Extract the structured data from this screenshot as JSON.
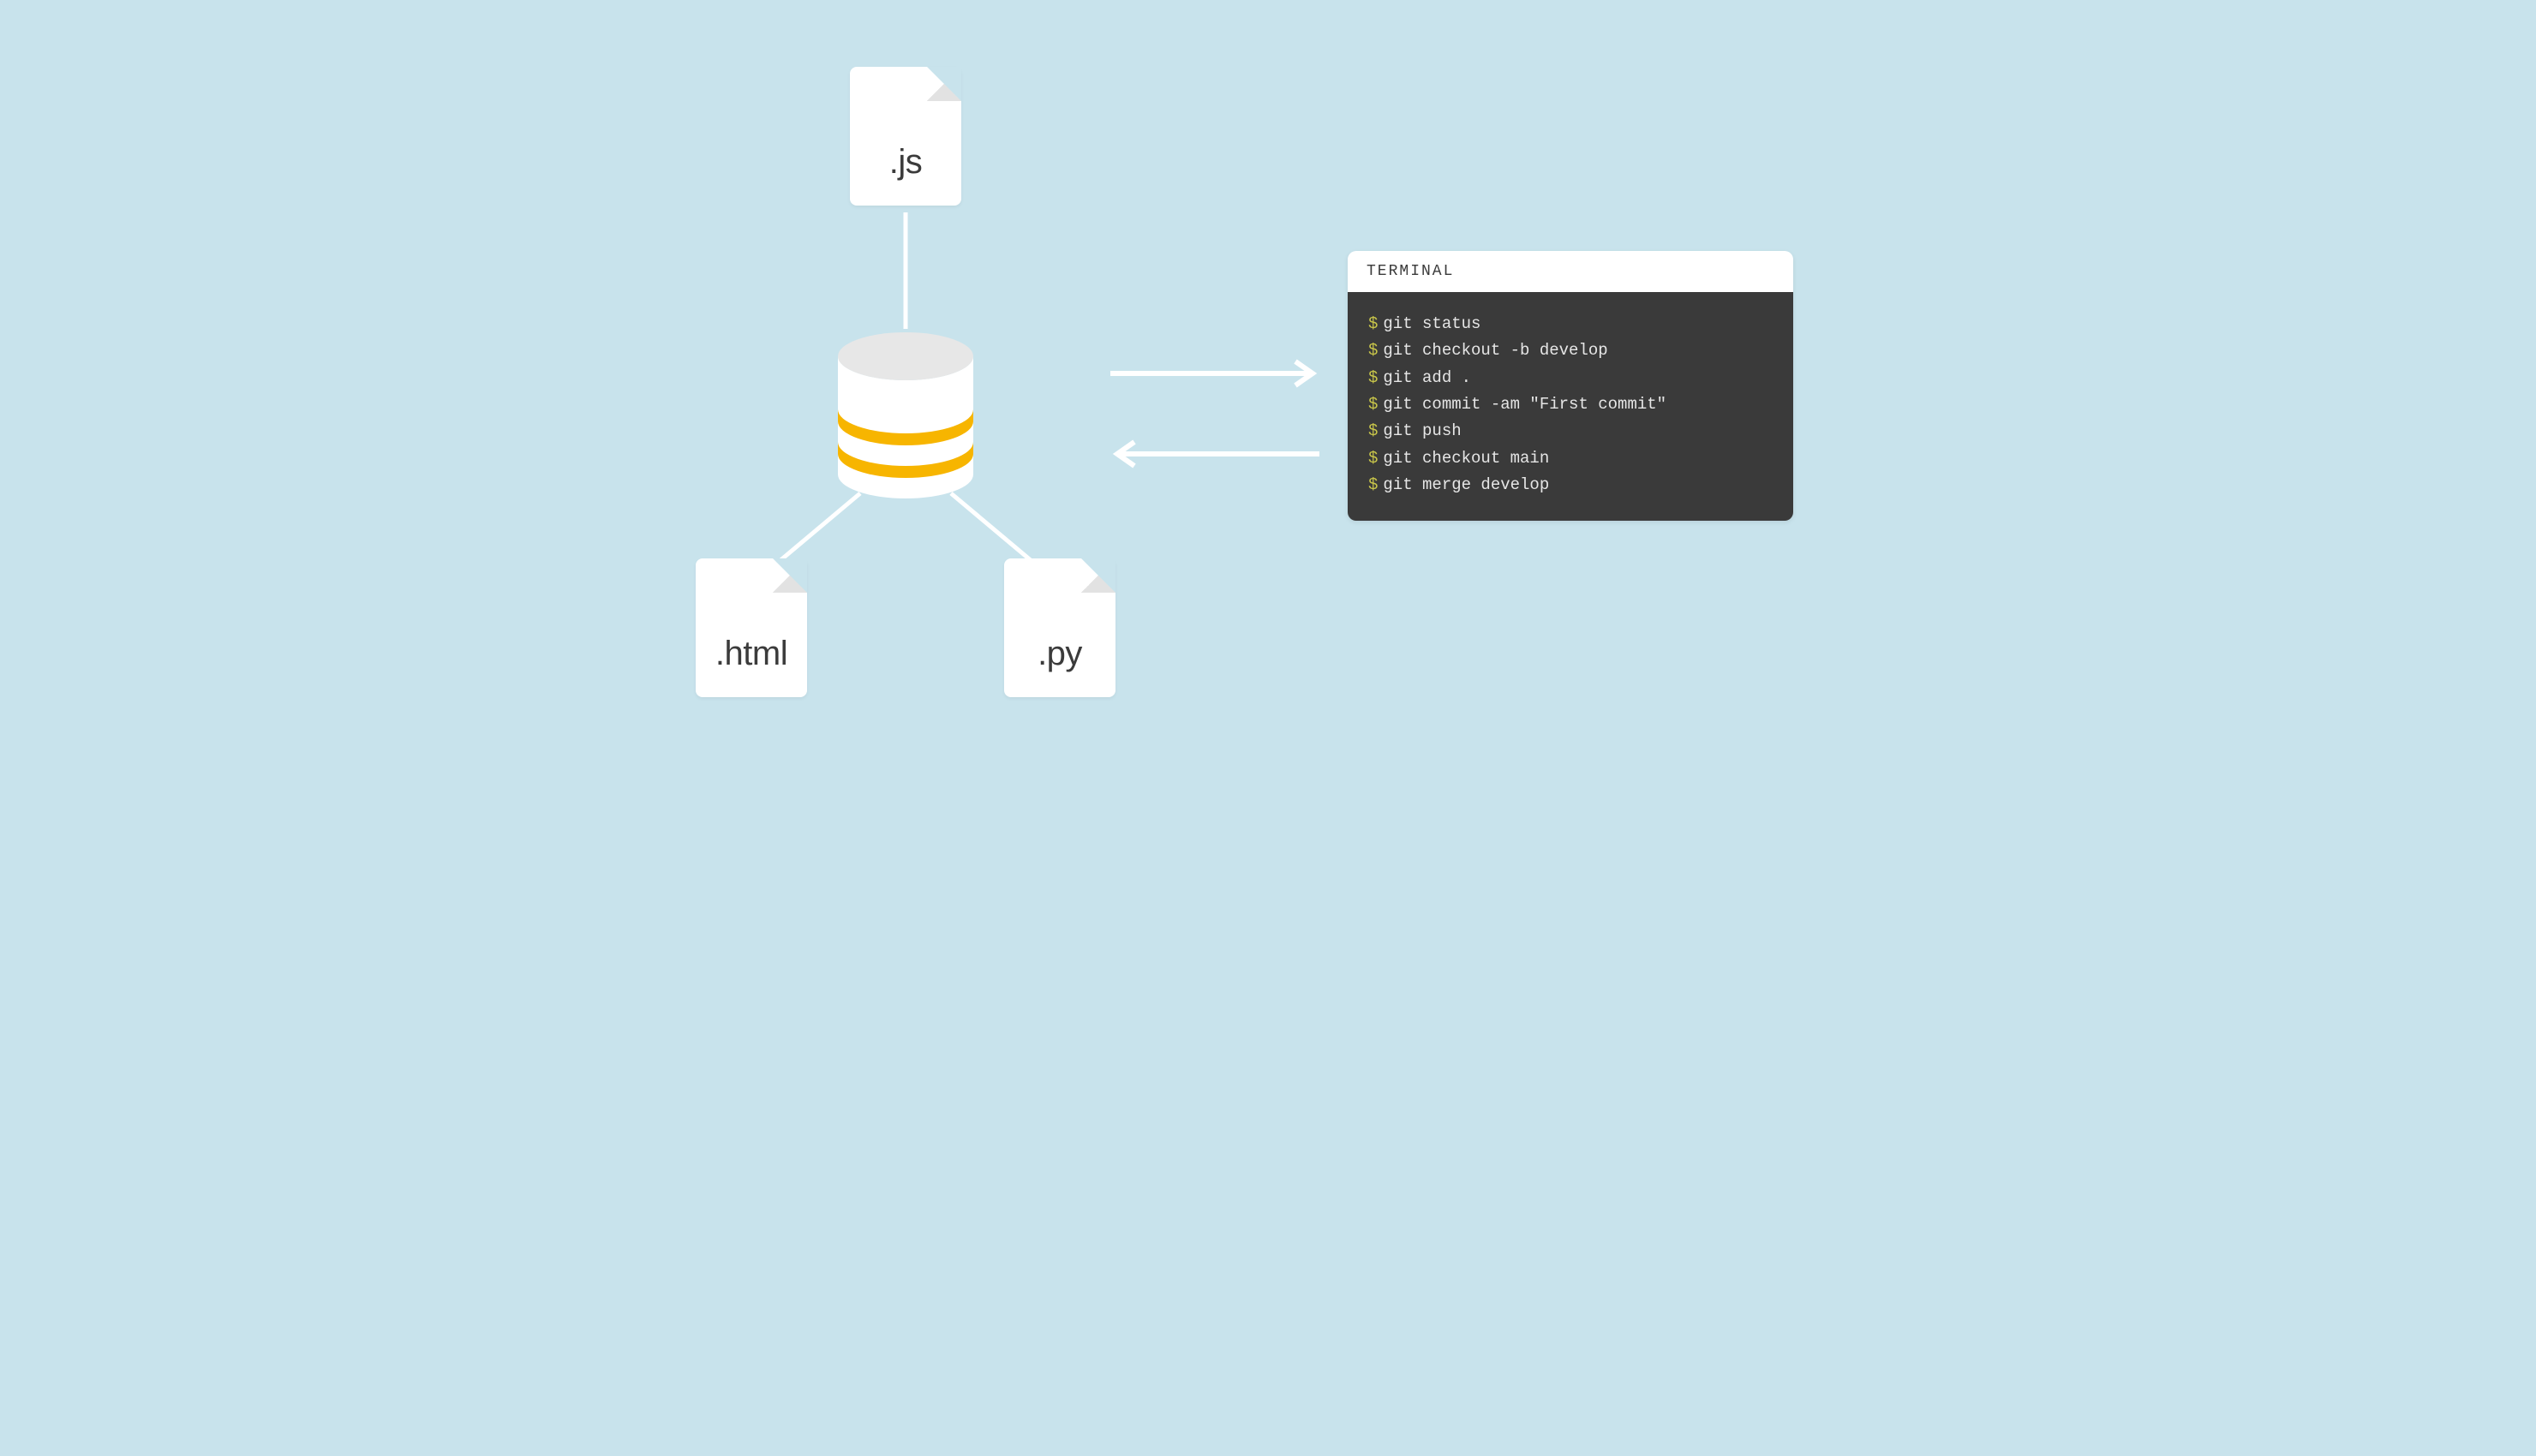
{
  "files": {
    "js": {
      "ext": ".js"
    },
    "html": {
      "ext": ".html"
    },
    "py": {
      "ext": ".py"
    }
  },
  "terminal": {
    "title": "TERMINAL",
    "prompt": "$",
    "lines": [
      "git status",
      "git checkout -b develop",
      "git add .",
      "git commit -am \"First commit\"",
      "git push",
      "git checkout main",
      "git merge develop"
    ]
  }
}
